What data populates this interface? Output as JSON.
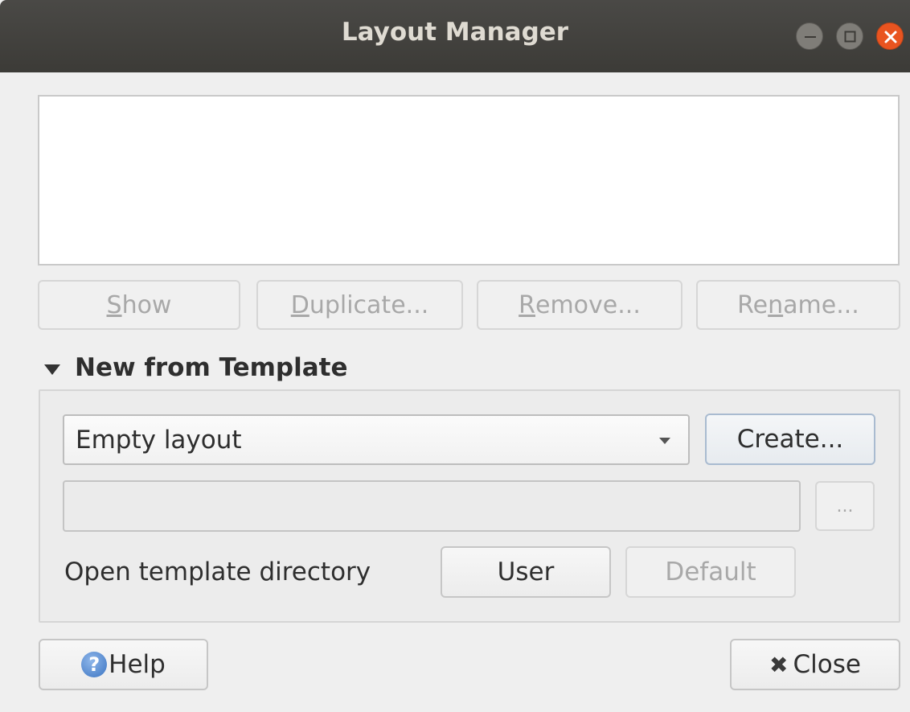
{
  "window": {
    "title": "Layout Manager",
    "controls": [
      "minimize-icon",
      "maximize-icon",
      "close-icon"
    ],
    "accent_close": "#e95420",
    "titlebar_color": "#3c3b37"
  },
  "layouts_list": {
    "items": []
  },
  "actions": {
    "show": {
      "before": "",
      "mnemonic": "S",
      "after": "how"
    },
    "duplicate": {
      "before": "",
      "mnemonic": "D",
      "after": "uplicate..."
    },
    "remove": {
      "before": "",
      "mnemonic": "R",
      "after": "emove..."
    },
    "rename": {
      "before": "Re",
      "mnemonic": "n",
      "after": "ame..."
    }
  },
  "template_section": {
    "header": "New from Template",
    "template_select": {
      "value": "Empty layout"
    },
    "create_label": "Create...",
    "path_value": "",
    "browse_label": "...",
    "open_dir_label": "Open template directory",
    "user_label": "User",
    "default_label": "Default"
  },
  "footer": {
    "help_label": "Help",
    "help_icon_glyph": "?",
    "close_label": "Close",
    "close_icon_glyph": "✖"
  }
}
